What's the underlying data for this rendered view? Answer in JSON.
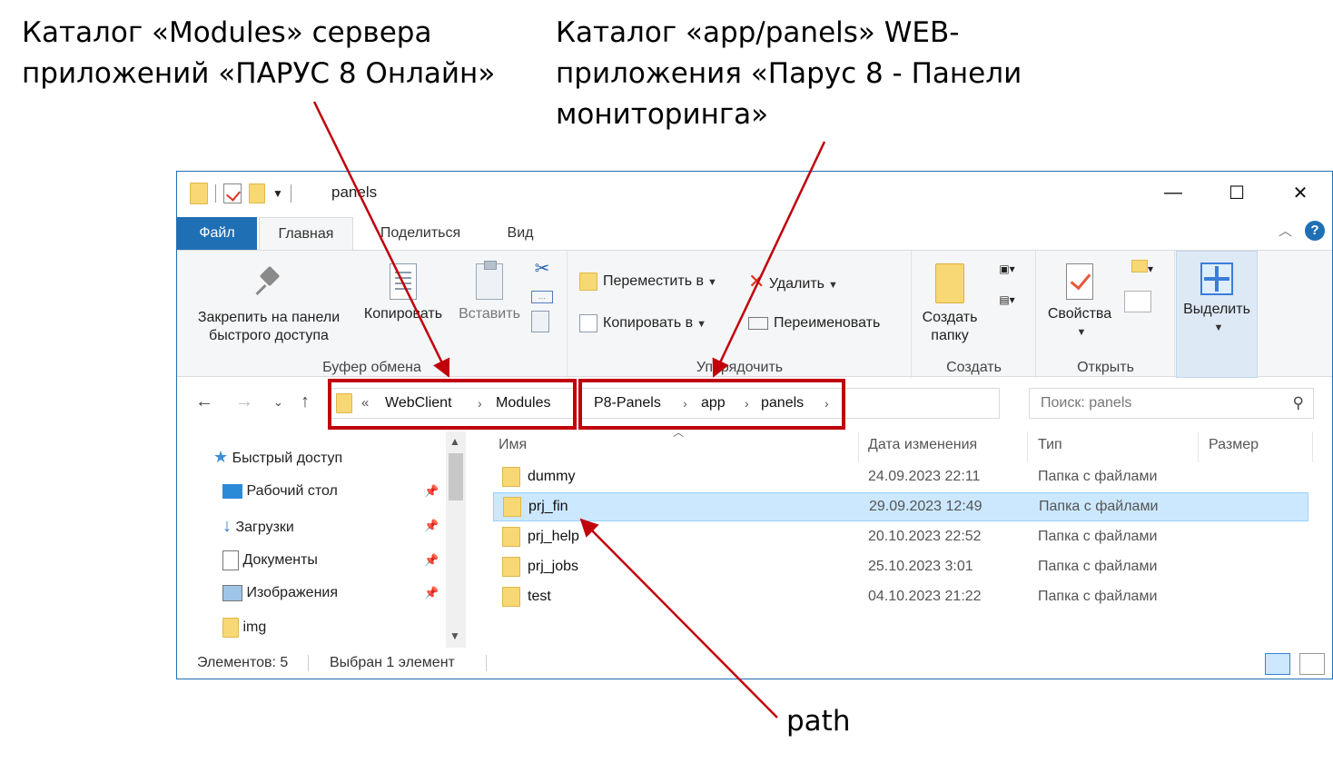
{
  "annotations": {
    "left_line1": "Каталог «Modules» сервера",
    "left_line2": "приложений «ПАРУС 8 Онлайн»",
    "right_line1": "Каталог «app/panels» WEB-",
    "right_line2": "приложения «Парус 8 - Панели",
    "right_line3": "мониторинга»",
    "bottom": "path",
    "arrow_color": "#c0000b"
  },
  "window": {
    "title": "panels",
    "controls": {
      "minimize": "—",
      "maximize": "☐",
      "close": "✕"
    },
    "accent": "#1f6fb5"
  },
  "tabs": {
    "file": "Файл",
    "home": "Главная",
    "share": "Поделиться",
    "view": "Вид"
  },
  "ribbon": {
    "clipboard": {
      "label": "Буфер обмена",
      "pin_line1": "Закрепить на панели",
      "pin_line2": "быстрого доступа",
      "copy": "Копировать",
      "paste": "Вставить"
    },
    "organize": {
      "label": "Упорядочить",
      "move_to": "Переместить в",
      "copy_to": "Копировать в",
      "delete": "Удалить",
      "rename": "Переименовать"
    },
    "create": {
      "label": "Создать",
      "new_folder_line1": "Создать",
      "new_folder_line2": "папку"
    },
    "open": {
      "label": "Открыть",
      "properties": "Свойства"
    },
    "select": {
      "label": "Выделить"
    }
  },
  "address": {
    "left_crumbs": {
      "overflow": "«",
      "c1": "WebClient",
      "c2": "Modules"
    },
    "right_crumbs": {
      "c1": "P8-Panels",
      "c2": "app",
      "c3": "panels"
    },
    "search_placeholder": "Поиск: panels"
  },
  "sidebar": {
    "quick_access": "Быстрый доступ",
    "items": [
      "Рабочий стол",
      "Загрузки",
      "Документы",
      "Изображения",
      "img"
    ]
  },
  "columns": {
    "name": "Имя",
    "date": "Дата изменения",
    "type": "Тип",
    "size": "Размер"
  },
  "files": [
    {
      "name": "dummy",
      "date": "24.09.2023 22:11",
      "type": "Папка с файлами"
    },
    {
      "name": "prj_fin",
      "date": "29.09.2023 12:49",
      "type": "Папка с файлами"
    },
    {
      "name": "prj_help",
      "date": "20.10.2023 22:52",
      "type": "Папка с файлами"
    },
    {
      "name": "prj_jobs",
      "date": "25.10.2023 3:01",
      "type": "Папка с файлами"
    },
    {
      "name": "test",
      "date": "04.10.2023 21:22",
      "type": "Папка с файлами"
    }
  ],
  "status": {
    "count": "Элементов: 5",
    "selected": "Выбран 1 элемент"
  }
}
